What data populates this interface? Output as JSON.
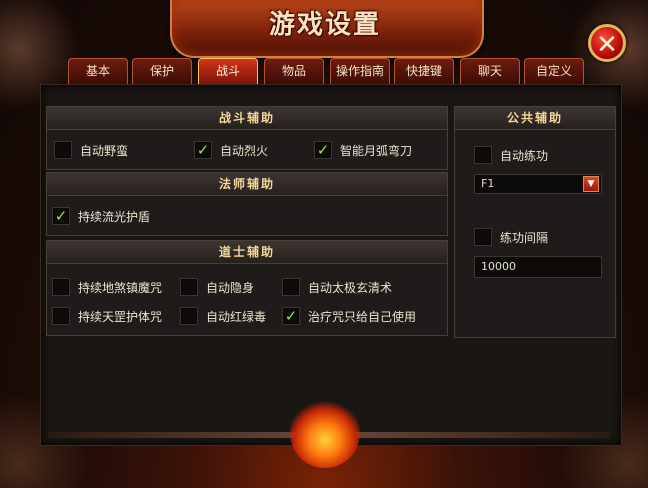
{
  "window": {
    "title": "游戏设置"
  },
  "tabs": [
    {
      "label": "基本",
      "active": false
    },
    {
      "label": "保护",
      "active": false
    },
    {
      "label": "战斗",
      "active": true
    },
    {
      "label": "物品",
      "active": false
    },
    {
      "label": "操作指南",
      "active": false
    },
    {
      "label": "快捷键",
      "active": false
    },
    {
      "label": "聊天",
      "active": false
    },
    {
      "label": "自定义",
      "active": false
    }
  ],
  "combat_assist": {
    "title": "战斗辅助",
    "options": [
      {
        "label": "自动野蛮",
        "checked": false
      },
      {
        "label": "自动烈火",
        "checked": true
      },
      {
        "label": "智能月弧弯刀",
        "checked": true
      }
    ]
  },
  "mage_assist": {
    "title": "法师辅助",
    "options": [
      {
        "label": "持续流光护盾",
        "checked": true
      }
    ]
  },
  "taoist_assist": {
    "title": "道士辅助",
    "options": [
      {
        "label": "持续地煞镇魔咒",
        "checked": false
      },
      {
        "label": "自动隐身",
        "checked": false
      },
      {
        "label": "自动太极玄清术",
        "checked": false
      },
      {
        "label": "持续天罡护体咒",
        "checked": false
      },
      {
        "label": "自动红绿毒",
        "checked": false
      },
      {
        "label": "治疗咒只给自己使用",
        "checked": true
      }
    ]
  },
  "public_assist": {
    "title": "公共辅助",
    "auto_practice": {
      "label": "自动练功",
      "checked": false
    },
    "hotkey_select": {
      "value": "F1"
    },
    "practice_interval": {
      "label": "练功间隔",
      "checked": false,
      "value": "10000"
    }
  },
  "colors": {
    "accent": "#d23418",
    "check": "#9de03a",
    "section_title": "#f3d89a"
  },
  "icons": {
    "close": "close-icon",
    "dropdown": "dropdown-arrow-icon",
    "check": "checkmark-icon"
  }
}
